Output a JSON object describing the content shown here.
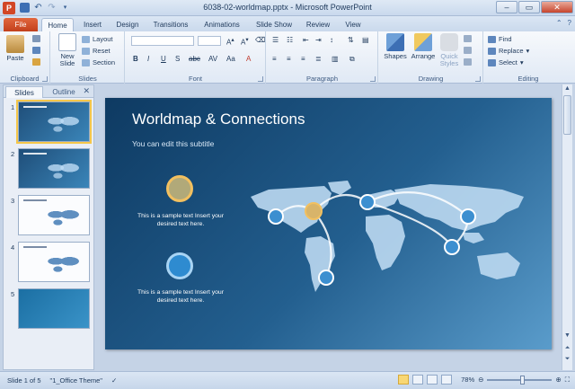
{
  "window": {
    "title": "6038-02-worldmap.pptx - Microsoft PowerPoint",
    "app_icon": "P",
    "controls": {
      "minimize": "–",
      "maximize": "▭",
      "close": "✕"
    }
  },
  "tabs": [
    "File",
    "Home",
    "Insert",
    "Design",
    "Transitions",
    "Animations",
    "Slide Show",
    "Review",
    "View"
  ],
  "active_tab": "Home",
  "ribbon": {
    "clipboard": {
      "label": "Clipboard",
      "paste": "Paste"
    },
    "slides": {
      "label": "Slides",
      "new_slide": "New Slide",
      "layout": "Layout",
      "reset": "Reset",
      "section": "Section"
    },
    "font": {
      "label": "Font",
      "size_label": "A"
    },
    "paragraph": {
      "label": "Paragraph"
    },
    "drawing": {
      "label": "Drawing",
      "shapes": "Shapes",
      "arrange": "Arrange",
      "quick_styles": "Quick Styles"
    },
    "editing": {
      "label": "Editing",
      "find": "Find",
      "replace": "Replace",
      "select": "Select"
    }
  },
  "left_panel": {
    "tab_slides": "Slides",
    "tab_outline": "Outline",
    "close": "✕",
    "thumbnails": [
      {
        "num": "1",
        "style": "dark"
      },
      {
        "num": "2",
        "style": "dark"
      },
      {
        "num": "3",
        "style": "light"
      },
      {
        "num": "4",
        "style": "light"
      },
      {
        "num": "5",
        "style": "blue"
      }
    ],
    "selected": 1
  },
  "slide": {
    "title": "Worldmap & Connections",
    "subtitle": "You can edit this subtitle",
    "text1": "This is a sample text Insert your desired text here.",
    "text2": "This is a sample text Insert your desired text here."
  },
  "status": {
    "slide_info": "Slide 1 of 5",
    "theme": "\"1_Office Theme\"",
    "zoom": "78%",
    "zoom_fraction": 0.55
  },
  "colors": {
    "file_tab": "#c2401c",
    "slide_bg_dark": "#0e3a62",
    "slide_bg_light": "#5a9ccb",
    "highlight_circle": "#f2c060",
    "node_circle": "#2e8bd0"
  }
}
